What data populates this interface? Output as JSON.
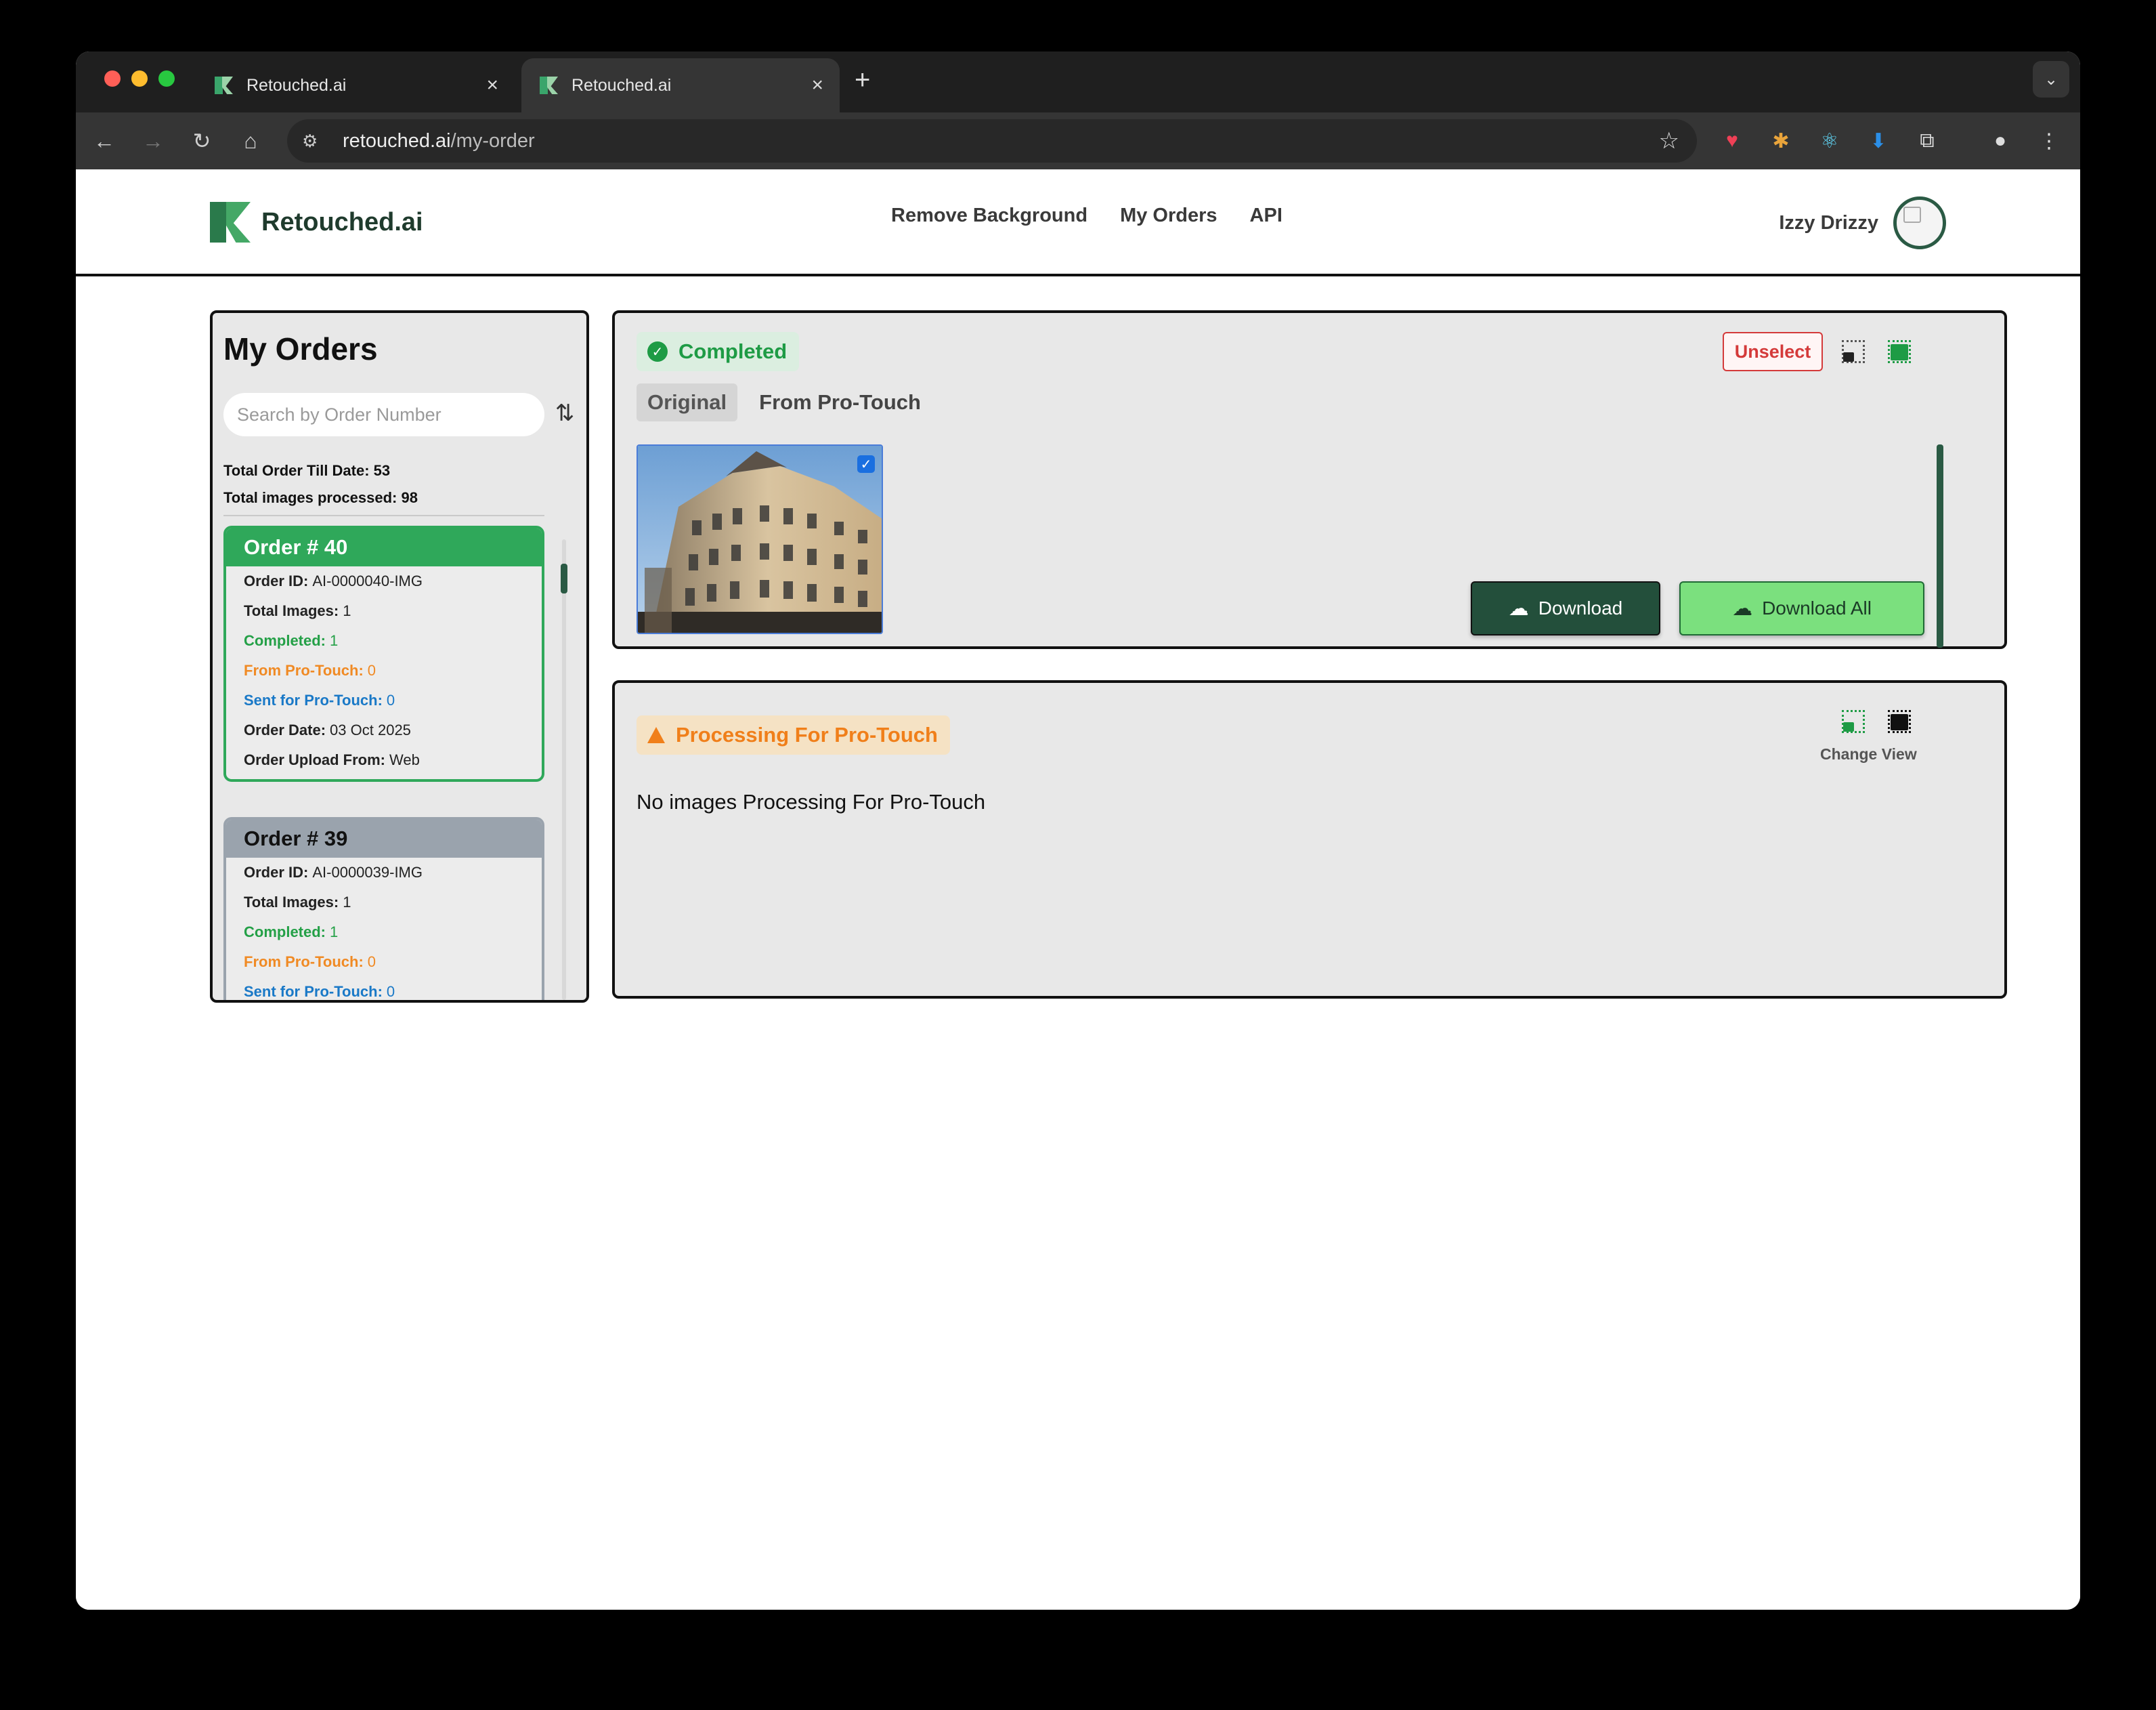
{
  "browser": {
    "tabs": [
      {
        "title": "Retouched.ai",
        "close": "×"
      },
      {
        "title": "Retouched.ai",
        "close": "×"
      }
    ],
    "new_tab": "+",
    "url_host": "retouched.ai",
    "url_path": "/my-order"
  },
  "header": {
    "logo_text": "Retouched.ai",
    "nav": [
      "Remove Background",
      "My Orders",
      "API"
    ],
    "user_name": "Izzy Drizzy"
  },
  "sidebar": {
    "title": "My Orders",
    "search_placeholder": "Search by Order Number",
    "total_orders_label": "Total Order Till Date: 53",
    "total_images_label": "Total images processed: 98",
    "orders": [
      {
        "title": "Order # 40",
        "order_id_label": "Order ID:",
        "order_id": "AI-0000040-IMG",
        "total_images_label": "Total Images:",
        "total_images": "1",
        "completed_label": "Completed:",
        "completed": "1",
        "from_pro_label": "From Pro-Touch:",
        "from_pro": "0",
        "sent_pro_label": "Sent for Pro-Touch:",
        "sent_pro": "0",
        "date_label": "Order Date:",
        "date": "03 Oct 2025",
        "upload_label": "Order Upload From:",
        "upload": "Web"
      },
      {
        "title": "Order # 39",
        "order_id_label": "Order ID:",
        "order_id": "AI-0000039-IMG",
        "total_images_label": "Total Images:",
        "total_images": "1",
        "completed_label": "Completed:",
        "completed": "1",
        "from_pro_label": "From Pro-Touch:",
        "from_pro": "0",
        "sent_pro_label": "Sent for Pro-Touch:",
        "sent_pro": "0"
      }
    ]
  },
  "completed_panel": {
    "status": "Completed",
    "tabs": [
      "Original",
      "From Pro-Touch"
    ],
    "unselect_label": "Unselect",
    "download_label": "Download",
    "download_all_label": "Download All"
  },
  "processing_panel": {
    "status": "Processing For Pro-Touch",
    "change_view_label": "Change View",
    "empty_message": "No images Processing For Pro-Touch"
  },
  "colors": {
    "accent_green": "#2fa85a",
    "dark_green": "#234f3b",
    "light_green": "#7be07e",
    "warning_orange": "#f07f1a",
    "danger_red": "#d43a3a",
    "info_blue": "#1a79c7"
  }
}
